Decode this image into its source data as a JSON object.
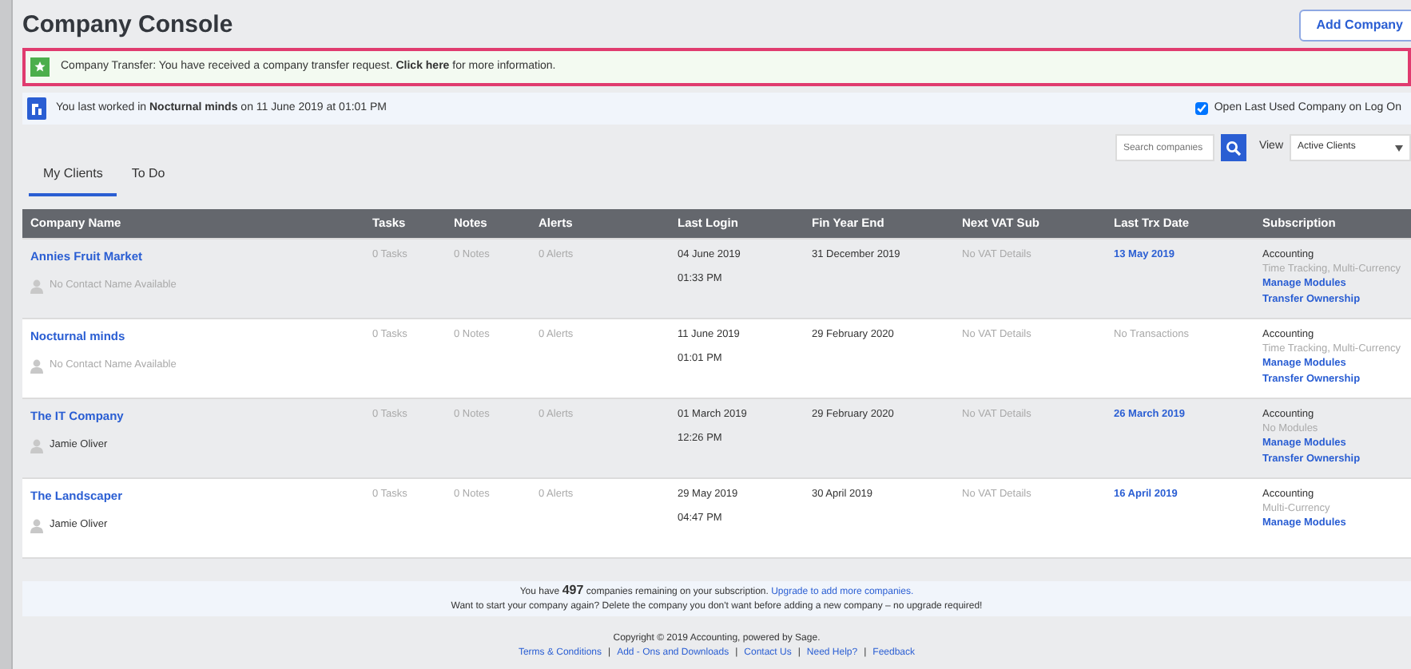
{
  "page_title": "Company Console",
  "add_button": "Add Company",
  "transfer_alert": {
    "before": "Company Transfer:  You have received a company transfer request. ",
    "link": "Click here",
    "after": " for more information."
  },
  "last_worked": {
    "text": "You last worked in **Nocturnal minds** on 11 June 2019 at 01:01 PM",
    "checkbox_label": "Open Last Used Company on Log On",
    "checked": true
  },
  "search": {
    "placeholder": "Search companies"
  },
  "view": {
    "label": "View",
    "value": "Active Clients"
  },
  "tabs": [
    {
      "label": "My Clients",
      "selected": true
    },
    {
      "label": "To Do",
      "selected": false
    }
  ],
  "table": {
    "columns": [
      "Company Name",
      "Tasks",
      "Notes",
      "Alerts",
      "Last Login",
      "Fin Year End",
      "Next VAT Sub",
      "Last Trx Date",
      "Subscription"
    ],
    "rows": [
      {
        "name": "Annies Fruit Market",
        "contact": "No Contact Name Available",
        "contact_missing": true,
        "tasks": "0 Tasks",
        "notes": "0 Notes",
        "alerts": "0 Alerts",
        "login_date": "04 June 2019",
        "login_time": "01:33 PM",
        "fin_year_end": "31 December 2019",
        "vat": "No VAT Details",
        "trx": {
          "text": "13 May 2019",
          "kind": "link"
        },
        "plan": "Accounting",
        "modules": "Time Tracking, Multi-Currency",
        "actions": [
          "Manage Modules",
          "Transfer Ownership"
        ]
      },
      {
        "name": "Nocturnal minds",
        "contact": "No Contact Name Available",
        "contact_missing": true,
        "tasks": "0 Tasks",
        "notes": "0 Notes",
        "alerts": "0 Alerts",
        "login_date": "11 June 2019",
        "login_time": "01:01 PM",
        "fin_year_end": "29 February 2020",
        "vat": "No VAT Details",
        "trx": {
          "text": "No Transactions",
          "kind": "empty"
        },
        "plan": "Accounting",
        "modules": "Time Tracking, Multi-Currency",
        "actions": [
          "Manage Modules",
          "Transfer Ownership"
        ]
      },
      {
        "name": "The IT Company",
        "contact": "Jamie Oliver",
        "contact_missing": false,
        "tasks": "0 Tasks",
        "notes": "0 Notes",
        "alerts": "0 Alerts",
        "login_date": "01 March 2019",
        "login_time": "12:26 PM",
        "fin_year_end": "29 February 2020",
        "vat": "No VAT Details",
        "trx": {
          "text": "26 March 2019",
          "kind": "link"
        },
        "plan": "Accounting",
        "modules": "No Modules",
        "actions": [
          "Manage Modules",
          "Transfer Ownership"
        ]
      },
      {
        "name": "The Landscaper",
        "contact": "Jamie Oliver",
        "contact_missing": false,
        "tasks": "0 Tasks",
        "notes": "0 Notes",
        "alerts": "0 Alerts",
        "login_date": "29 May 2019",
        "login_time": "04:47 PM",
        "fin_year_end": "30 April 2019",
        "vat": "No VAT Details",
        "trx": {
          "text": "16 April 2019",
          "kind": "link"
        },
        "plan": "Accounting",
        "modules": "Multi-Currency",
        "actions": [
          "Manage Modules"
        ]
      }
    ]
  },
  "subscription_info": {
    "text": "You have **497** companies remaining on your subscription. ",
    "link": "Upgrade to add more companies.",
    "note": "Want to start your company again? Delete the company you don't want before adding a new company – no upgrade required!"
  },
  "footer": {
    "copyright": "Copyright © 2019 Accounting, powered by Sage.",
    "links": [
      "Terms & Conditions",
      "Add - Ons and Downloads",
      "Contact Us",
      "Need Help?",
      "Feedback"
    ],
    "separator": "|"
  }
}
